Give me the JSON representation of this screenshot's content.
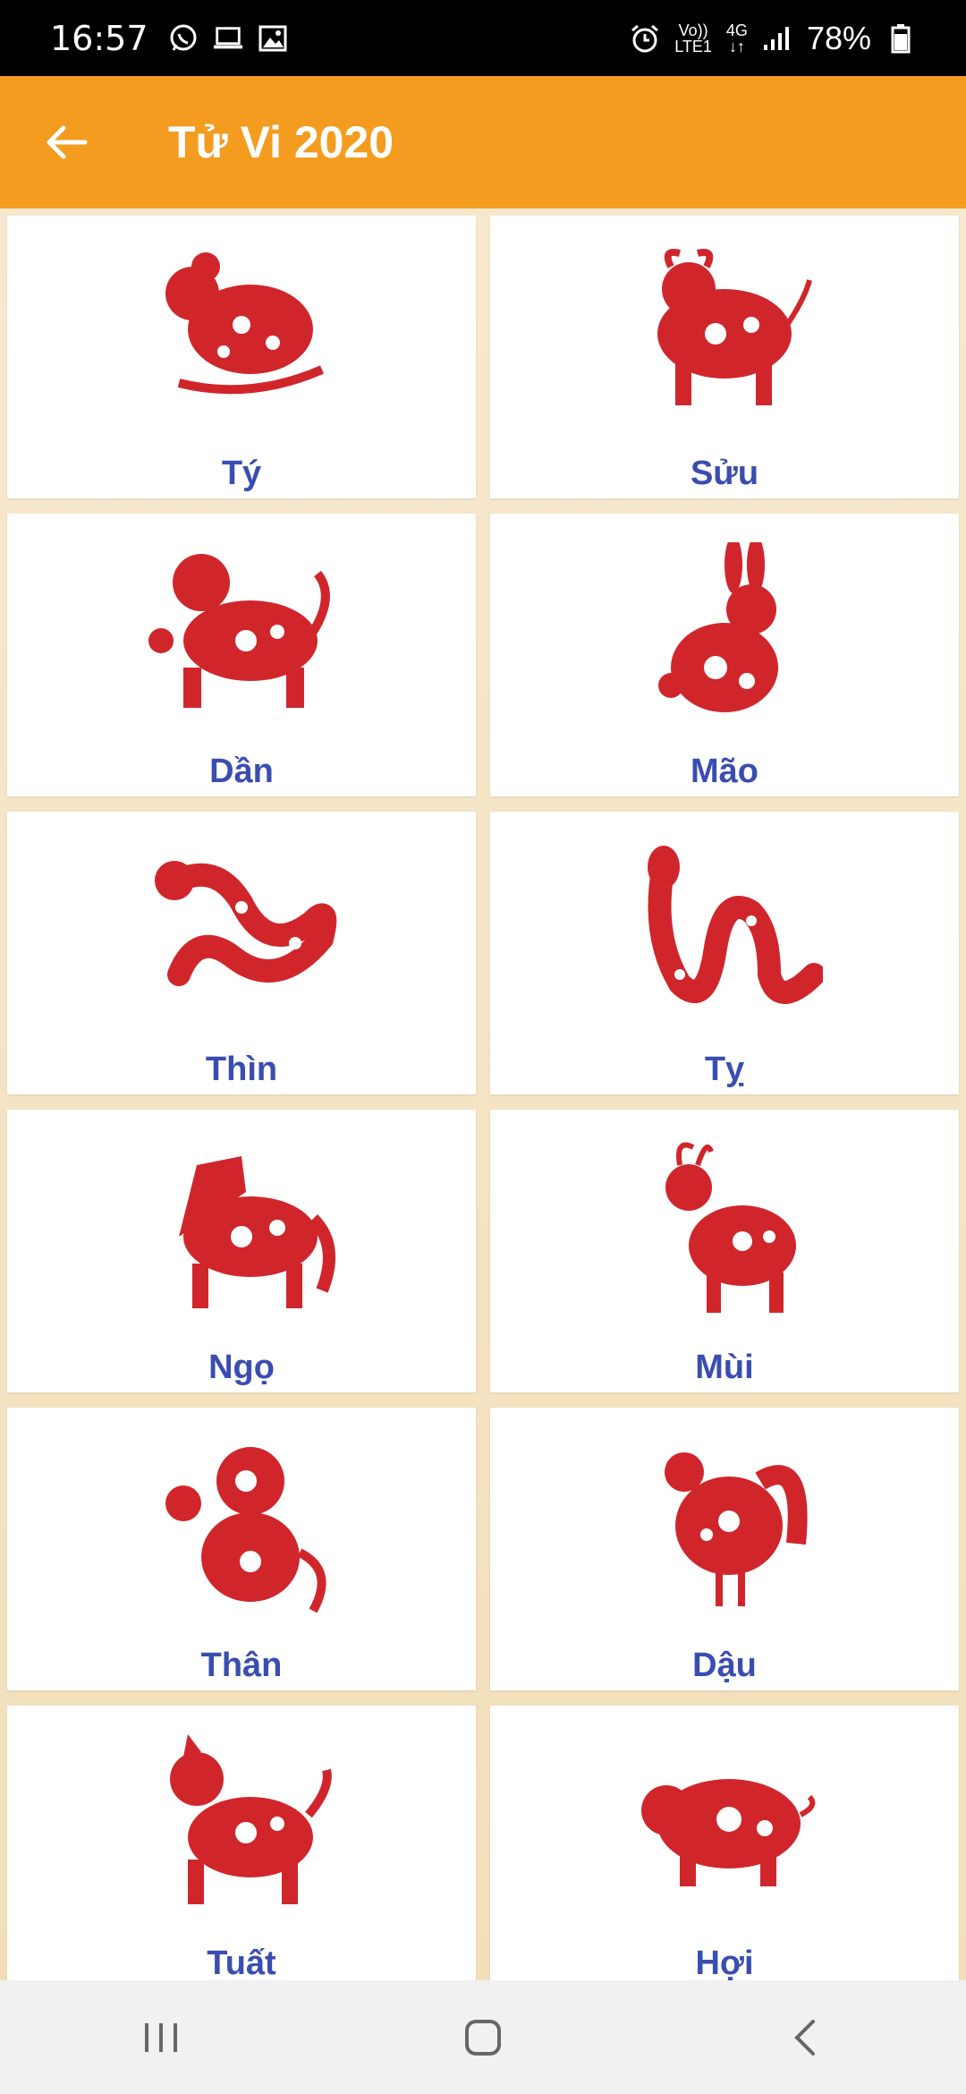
{
  "status_bar": {
    "time": "16:57",
    "volte_top": "Vo))",
    "volte_bottom": "LTE1",
    "network": "4G",
    "battery": "78%",
    "icons": [
      "whatsapp-icon",
      "laptop-icon",
      "image-icon",
      "alarm-icon",
      "signal-icon",
      "battery-icon"
    ]
  },
  "app_bar": {
    "title": "Tử Vi 2020",
    "back_icon": "arrow-left-icon"
  },
  "zodiac": [
    {
      "label": "Tý",
      "icon": "rat-icon"
    },
    {
      "label": "Sửu",
      "icon": "ox-icon"
    },
    {
      "label": "Dần",
      "icon": "tiger-icon"
    },
    {
      "label": "Mão",
      "icon": "rabbit-icon"
    },
    {
      "label": "Thìn",
      "icon": "dragon-icon"
    },
    {
      "label": "Tỵ",
      "icon": "snake-icon"
    },
    {
      "label": "Ngọ",
      "icon": "horse-icon"
    },
    {
      "label": "Mùi",
      "icon": "goat-icon"
    },
    {
      "label": "Thân",
      "icon": "monkey-icon"
    },
    {
      "label": "Dậu",
      "icon": "rooster-icon"
    },
    {
      "label": "Tuất",
      "icon": "dog-icon"
    },
    {
      "label": "Hợi",
      "icon": "pig-icon"
    }
  ],
  "colors": {
    "accent": "#f39c1f",
    "label": "#3a4db0",
    "papercut_red": "#d0262b"
  },
  "nav_bar": {
    "icons": [
      "recent-apps-icon",
      "home-icon",
      "back-icon"
    ]
  }
}
